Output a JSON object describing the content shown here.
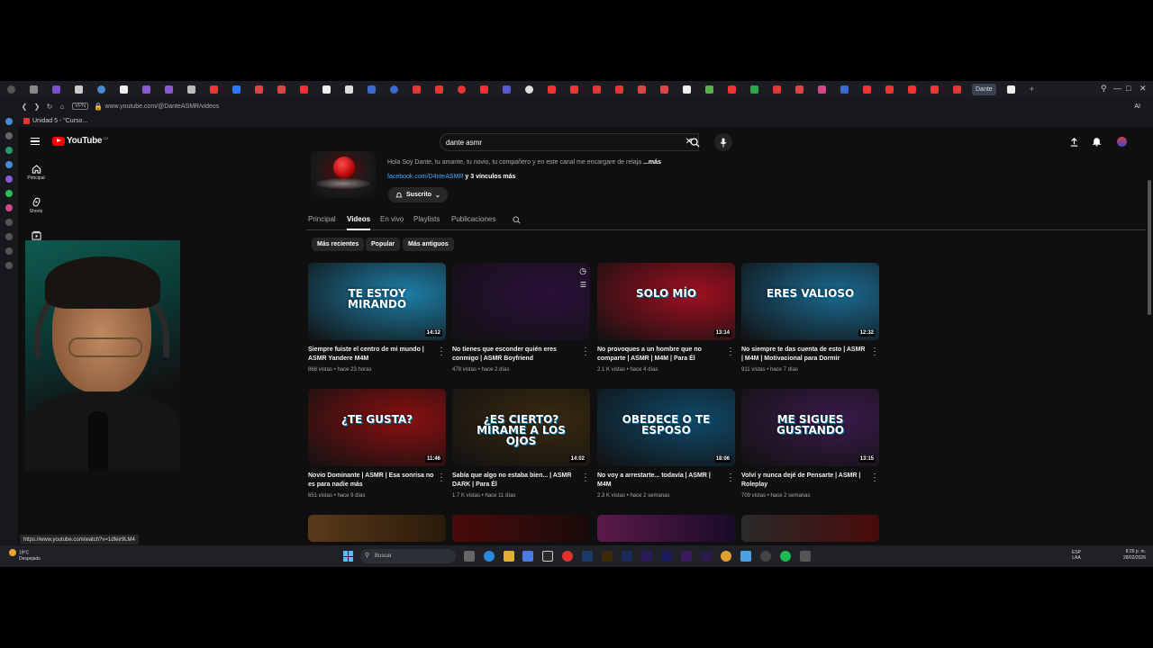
{
  "browser": {
    "active_tab_label": "Dante",
    "url": "www.youtube.com/@DanteASMR/videos",
    "vpn_label": "VPN",
    "bookmark": "Unidad 5 - \"Curso...",
    "ai_label": "AI"
  },
  "header": {
    "logo_text": "YouTube",
    "logo_country": "CO",
    "search_value": "dante asmr"
  },
  "rail": {
    "items": [
      {
        "label": "Principal"
      },
      {
        "label": "Shorts"
      },
      {
        "label": "Su"
      }
    ]
  },
  "channel": {
    "description": "Hola Soy Dante, tu amante, tu novio, tu compañero y en este canal me encargare de relaja",
    "more_label": "...más",
    "link": "facebook.com/D4nteASMR",
    "links_more": "y 3 vínculos más",
    "subscribe_label": "Suscrito"
  },
  "tabs": [
    {
      "label": "Principal"
    },
    {
      "label": "Videos"
    },
    {
      "label": "En vivo"
    },
    {
      "label": "Playlists"
    },
    {
      "label": "Publicaciones"
    }
  ],
  "chips": [
    {
      "label": "Más recientes"
    },
    {
      "label": "Popular"
    },
    {
      "label": "Más antiguos"
    }
  ],
  "videos": [
    {
      "title": "Siempre fuiste el centro de mi mundo | ASMR Yandere M4M",
      "meta": "868 vistas • hace 23 horas",
      "duration": "14:12",
      "thumb_text": "TE ESTOY MIRANDO",
      "color": "#1e7fa8"
    },
    {
      "title": "No tienes que esconder quién eres conmigo | ASMR Boyfriend",
      "meta": "478 vistas • hace 2 días",
      "duration": "",
      "thumb_text": "",
      "color": "#2a0f3a"
    },
    {
      "title": "No provoques a un hombre que no comparte | ASMR | M4M | Para Él",
      "meta": "2.1 K vistas • hace 4 días",
      "duration": "13:14",
      "thumb_text": "SOLO MÍO",
      "color": "#a01020"
    },
    {
      "title": "No siempre te das cuenta de esto | ASMR | M4M | Motivacional para Dormir",
      "meta": "911 vistas • hace 7 días",
      "duration": "12:32",
      "thumb_text": "ERES VALIOSO",
      "color": "#1a6a90"
    },
    {
      "title": "Novio Dominante | ASMR | Esa sonrisa no es para nadie más",
      "meta": "651 vistas • hace 9 días",
      "duration": "11:46",
      "thumb_text": "¿TE GUSTA?",
      "color": "#8a1010"
    },
    {
      "title": "Sabía que algo no estaba bien... | ASMR DARK | Para Él",
      "meta": "1.7 K vistas • hace 11 días",
      "duration": "14:02",
      "thumb_text": "¿ES CIERTO? MÍRAME A LOS OJOS",
      "color": "#3a2a10"
    },
    {
      "title": "No voy a arrestarte... todavía | ASMR | M4M",
      "meta": "2.3 K vistas • hace 2 semanas",
      "duration": "18:06",
      "thumb_text": "OBEDECE O TE ESPOSO",
      "color": "#0f4a6a"
    },
    {
      "title": "Volví y nunca dejé de Pensarte | ASMR | Roleplay",
      "meta": "709 vistas • hace 2 semanas",
      "duration": "13:15",
      "thumb_text": "ME SIGUES GUSTANDO",
      "color": "#3a1a4a"
    }
  ],
  "hover_url": "https://www.youtube.com/watch?v=1dfeir9LM4",
  "taskbar": {
    "weather_temp": "19°C",
    "weather_desc": "Despejado",
    "search_label": "Buscar",
    "lang_top": "ESP",
    "lang_bottom": "LAA",
    "time": "8:26 p. m.",
    "date": "28/02/2026"
  },
  "colors": {
    "accent": "#ff0000",
    "link": "#3ea6ff",
    "bg": "#0f0f0f"
  }
}
